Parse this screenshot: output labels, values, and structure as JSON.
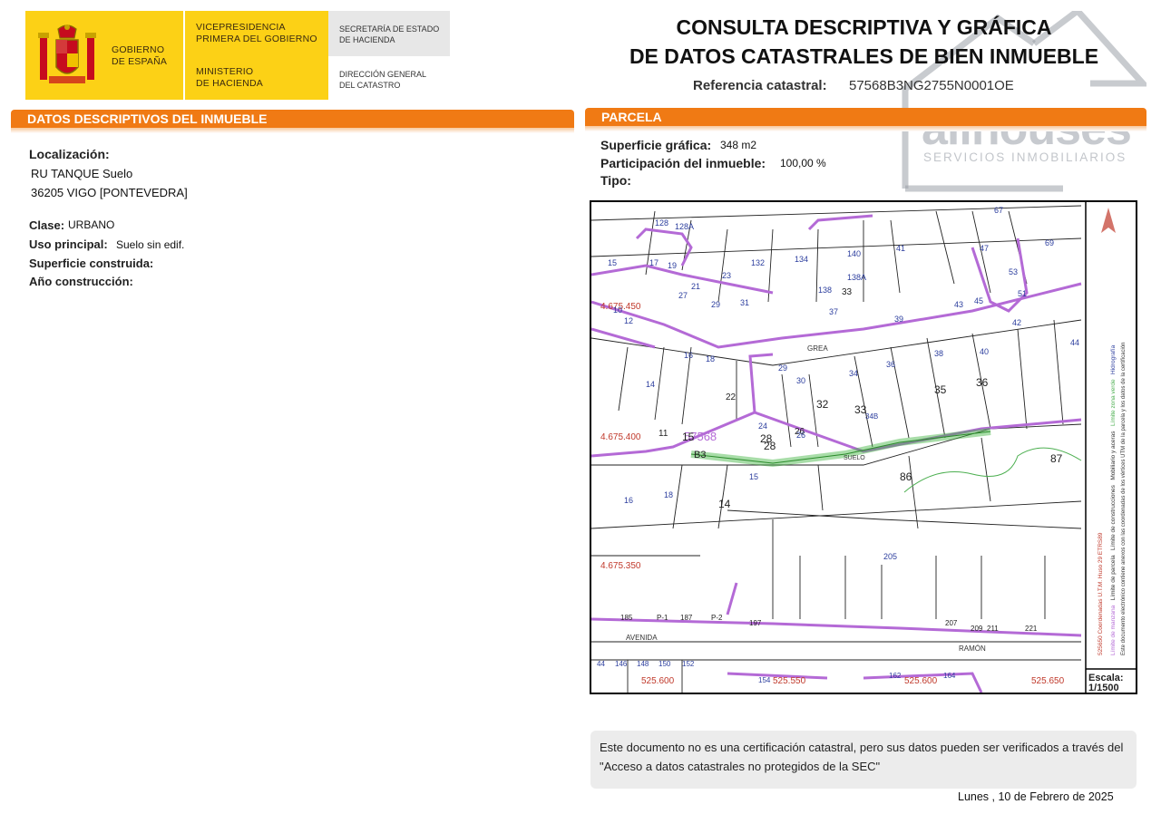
{
  "header": {
    "logo_gov_line1": "GOBIERNO",
    "logo_gov_line2": "DE ESPAÑA",
    "logo_vice_line1": "VICEPRESIDENCIA",
    "logo_vice_line2": "PRIMERA DEL GOBIERNO",
    "logo_min_line1": "MINISTERIO",
    "logo_min_line2": "DE HACIENDA",
    "logo_sec_line1": "SECRETARÍA DE ESTADO",
    "logo_sec_line2": "DE HACIENDA",
    "logo_dg_line1": "DIRECCIÓN GENERAL",
    "logo_dg_line2": "DEL CATASTRO",
    "title_line1": "CONSULTA DESCRIPTIVA Y GRÁFICA",
    "title_line2": "DE DATOS CATASTRALES DE BIEN INMUEBLE",
    "ref_label": "Referencia catastral:",
    "ref_value": "57568B3NG2755N0001OE"
  },
  "watermark": {
    "brand": "allhouses",
    "tagline": "SERVICIOS INMOBILIARIOS"
  },
  "left_section": {
    "title": "DATOS DESCRIPTIVOS DEL INMUEBLE",
    "localizacion_label": "Localización:",
    "localizacion_line1": "RU TANQUE  Suelo",
    "localizacion_line2": "36205 VIGO [PONTEVEDRA]",
    "clase_label": "Clase:",
    "clase_value": "URBANO",
    "uso_label": "Uso principal:",
    "uso_value": "Suelo sin edif.",
    "sup_construida_label": "Superficie construida:",
    "anio_label": "Año construcción:"
  },
  "right_section": {
    "title": "PARCELA",
    "sup_grafica_label": "Superficie gráfica:",
    "sup_grafica_value": "348 m2",
    "participacion_label": "Participación del inmueble:",
    "participacion_value": "100,00 %",
    "tipo_label": "Tipo:"
  },
  "map": {
    "coord_y1": "4.675.450",
    "coord_y2": "4.675.400",
    "coord_y3": "4.675.350",
    "coord_x1": "525.600",
    "coord_x2": "525.550",
    "coord_x3": "525.600",
    "coord_x4": "525.650",
    "block_label": "57568",
    "parcel_label": "B3",
    "street_grea": "GREA",
    "street_avenida": "AVENIDA",
    "street_ramon": "RAMÓN",
    "street_suelo": "SUELO",
    "numbers": [
      "128",
      "128A",
      "19",
      "17",
      "15",
      "23",
      "132",
      "134",
      "140",
      "41",
      "67",
      "69",
      "47",
      "53",
      "51",
      "43",
      "45",
      "42",
      "44",
      "138",
      "138A",
      "33",
      "37",
      "39",
      "40",
      "38",
      "36",
      "34",
      "32",
      "33",
      "35",
      "36",
      "30",
      "29",
      "28",
      "26",
      "22",
      "16",
      "18",
      "14",
      "11",
      "15",
      "24",
      "28",
      "26",
      "27",
      "29",
      "21",
      "31",
      "86",
      "87",
      "14",
      "15",
      "16",
      "18",
      "205",
      "185",
      "187",
      "197",
      "207",
      "209",
      "211",
      "221",
      "44",
      "146",
      "148",
      "150",
      "152",
      "154",
      "162",
      "164",
      "P-1",
      "P-2",
      "34B",
      "10",
      "12"
    ],
    "scale_label": "Escala:",
    "scale_value": "1/1500",
    "legend_items": [
      "Límite de manzana",
      "Límite de parcela",
      "Límite de construcciones",
      "Mobiliario y aceras",
      "Límite zona verde",
      "Hidrografía"
    ],
    "legend_note": "Este documento electrónico contiene anexos con las coordenadas de los vértices UTM de la parcela y los datos de la certificación",
    "legend_coords": "525650 Coordenadas U.T.M. Huso 29 ETRS89"
  },
  "footer": {
    "note": "Este documento no es una certificación catastral, pero sus datos pueden ser verificados a través del \"Acceso a datos catastrales no protegidos de la SEC\"",
    "date": "Lunes , 10 de Febrero de 2025"
  }
}
